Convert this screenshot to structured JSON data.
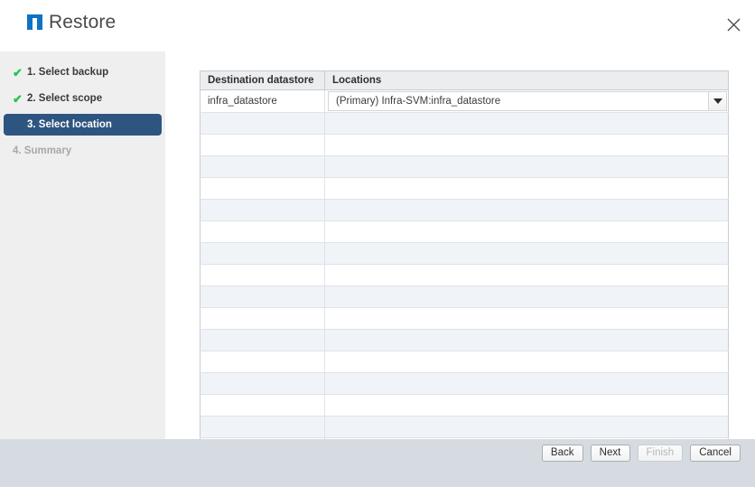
{
  "window": {
    "title": "Restore",
    "logo_icon": "netapp-logo-icon",
    "close_icon": "close-icon",
    "accent_color": "#0d72c4",
    "selected_step_color": "#2d5580",
    "check_color": "#23c552"
  },
  "sidebar": {
    "steps": [
      {
        "label": "1. Select backup",
        "state": "done",
        "check": "✔"
      },
      {
        "label": "2. Select scope",
        "state": "done",
        "check": "✔"
      },
      {
        "label": "3. Select location",
        "state": "current",
        "check": ""
      },
      {
        "label": "4. Summary",
        "state": "upcoming",
        "check": ""
      }
    ]
  },
  "main": {
    "table": {
      "columns": [
        "Destination datastore",
        "Locations"
      ],
      "rows": [
        {
          "destination": "infra_datastore",
          "location_value": "(Primary) Infra-SVM:infra_datastore",
          "has_select": true
        }
      ],
      "empty_row_count": 17,
      "dropdown_icon": "chevron-down-icon"
    }
  },
  "footer": {
    "buttons": [
      {
        "label": "Back",
        "disabled": false
      },
      {
        "label": "Next",
        "disabled": false
      },
      {
        "label": "Finish",
        "disabled": true
      },
      {
        "label": "Cancel",
        "disabled": false
      }
    ]
  }
}
